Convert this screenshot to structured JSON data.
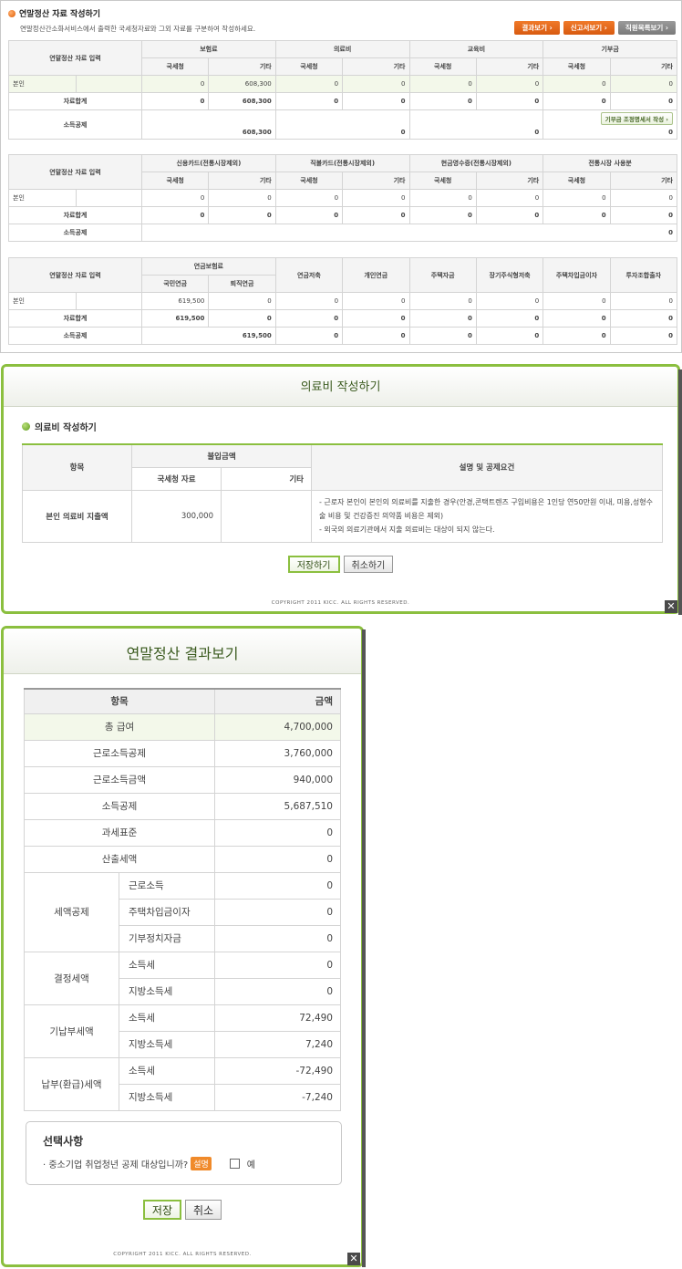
{
  "main": {
    "title": "연말정산 자료 작성하기",
    "description": "연말정산간소화서비스에서 출력한 국세청자료와 그외 자료를 구분하여 작성하세요.",
    "buttons": {
      "result": "결과보기 ›",
      "report": "신고서보기 ›",
      "list": "직원목록보기 ›"
    },
    "input_label": "연말정산 자료 입력",
    "row_self": "본인",
    "row_total": "자료합계",
    "row_deduction": "소득공제",
    "nts": "국세청",
    "etc": "기타",
    "table1": {
      "groups": [
        "보험료",
        "의료비",
        "교육비",
        "기부금"
      ],
      "self": [
        "0",
        "608,300",
        "0",
        "0",
        "0",
        "0",
        "0",
        "0"
      ],
      "total": [
        "0",
        "608,300",
        "0",
        "0",
        "0",
        "0",
        "0",
        "0"
      ],
      "deduction": [
        "608,300",
        "0",
        "0",
        "0"
      ],
      "donation_button": "기부금 조정명세서 작성 ›"
    },
    "table2": {
      "groups": [
        "신용카드(전통시장제외)",
        "직불카드(전통시장제외)",
        "현금영수증(전통시장제외)",
        "전통시장 사용분"
      ],
      "self": [
        "0",
        "0",
        "0",
        "0",
        "0",
        "0",
        "0",
        "0"
      ],
      "total": [
        "0",
        "0",
        "0",
        "0",
        "0",
        "0",
        "0",
        "0"
      ],
      "deduction": "0"
    },
    "table3": {
      "pension_group": "연금보험료",
      "pension_cols": [
        "국민연금",
        "퇴직연금"
      ],
      "cols": [
        "연금저축",
        "개인연금",
        "주택자금",
        "장기주식형저축",
        "주택차입금이자",
        "투자조합출자"
      ],
      "self": [
        "619,500",
        "0",
        "0",
        "0",
        "0",
        "0",
        "0",
        "0"
      ],
      "total": [
        "619,500",
        "0",
        "0",
        "0",
        "0",
        "0",
        "0",
        "0"
      ],
      "deduction": [
        "619,500",
        "0",
        "0",
        "0",
        "0",
        "0",
        "0"
      ]
    }
  },
  "medical_popup": {
    "header": "의료비 작성하기",
    "subtitle": "의료비 작성하기",
    "col_item": "항목",
    "col_paid": "불입금액",
    "col_nts": "국세청 자료",
    "col_etc": "기타",
    "col_desc": "설명 및 공제요건",
    "row_label": "본인 의료비 지출액",
    "row_nts": "300,000",
    "row_etc": "",
    "desc1": "- 근로자 본인이 본인의 의료비를 지출한 경우(안경,콘택트렌즈 구입비용은 1인당 연50만원 이내, 미용,성형수술 비용 및 건강증진 의약품 비용은 제외)",
    "desc2": "- 외국의 의료기관에서 지출 의료비는 대상이 되지 않는다.",
    "save": "저장하기",
    "cancel": "취소하기",
    "copyright": "COPYRIGHT  2011 KICC. ALL RIGHTS RESERVED."
  },
  "result_popup": {
    "header": "연말정산 결과보기",
    "col_item": "항목",
    "col_amount": "금액",
    "rows": [
      {
        "label": "총 급여",
        "value": "4,700,000"
      },
      {
        "label": "근로소득공제",
        "value": "3,760,000"
      },
      {
        "label": "근로소득금액",
        "value": "940,000"
      },
      {
        "label": "소득공제",
        "value": "5,687,510"
      },
      {
        "label": "과세표준",
        "value": "0"
      },
      {
        "label": "산출세액",
        "value": "0"
      }
    ],
    "tax_credit": {
      "label": "세액공제",
      "items": [
        {
          "label": "근로소득",
          "value": "0"
        },
        {
          "label": "주택차입금이자",
          "value": "0"
        },
        {
          "label": "기부정치자금",
          "value": "0"
        }
      ]
    },
    "determined": {
      "label": "결정세액",
      "items": [
        {
          "label": "소득세",
          "value": "0"
        },
        {
          "label": "지방소득세",
          "value": "0"
        }
      ]
    },
    "prepaid": {
      "label": "기납부세액",
      "items": [
        {
          "label": "소득세",
          "value": "72,490"
        },
        {
          "label": "지방소득세",
          "value": "7,240"
        }
      ]
    },
    "payable": {
      "label": "납부(환급)세액",
      "items": [
        {
          "label": "소득세",
          "value": "-72,490"
        },
        {
          "label": "지방소득세",
          "value": "-7,240"
        }
      ]
    },
    "options_title": "선택사항",
    "options_question": "· 중소기업 취업청년 공제 대상입니까?",
    "options_badge": "설명",
    "options_yes": "예",
    "save": "저장",
    "cancel": "취소",
    "copyright": "COPYRIGHT  2011 KICC. ALL RIGHTS RESERVED."
  }
}
